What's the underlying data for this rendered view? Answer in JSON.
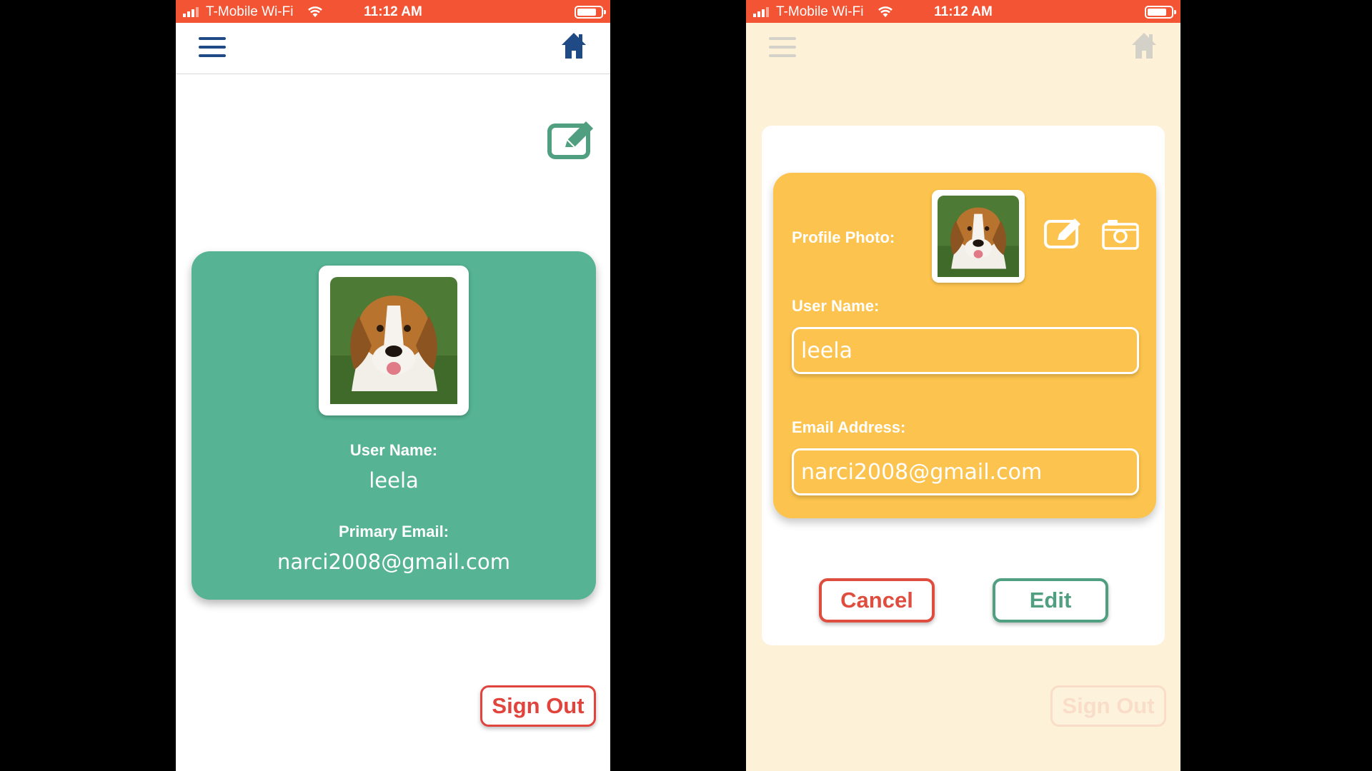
{
  "status_bar": {
    "carrier": "T-Mobile Wi-Fi",
    "time": "11:12 AM"
  },
  "colors": {
    "status_bar": "#f25434",
    "nav_icon": "#1f4a86",
    "profile_card": "#56b394",
    "edit_card": "#fcc44e",
    "danger": "#e0443d"
  },
  "profile_screen": {
    "user_name_label": "User Name:",
    "user_name": "leela",
    "email_label": "Primary Email:",
    "email": "narci2008@gmail.com",
    "sign_out_label": "Sign Out"
  },
  "edit_dialog": {
    "profile_photo_label": "Profile Photo:",
    "user_name_label": "User Name:",
    "user_name_value": "leela",
    "email_label": "Email Address:",
    "email_value": "narci2008@gmail.com",
    "cancel_label": "Cancel",
    "edit_label": "Edit"
  },
  "icons": [
    "hamburger-menu-icon",
    "home-icon",
    "edit-profile-icon",
    "pencil-icon",
    "camera-icon",
    "wifi-icon",
    "battery-icon",
    "signal-icon"
  ]
}
